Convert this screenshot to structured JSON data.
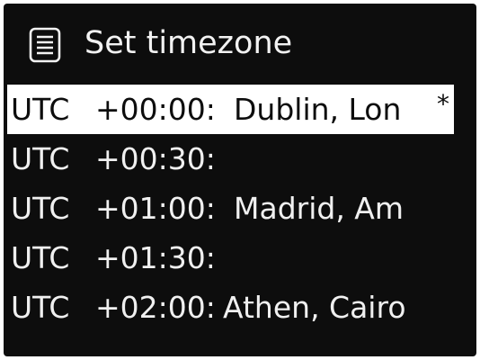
{
  "header": {
    "title": "Set timezone",
    "icon": "menu-list-icon"
  },
  "timezones": [
    {
      "prefix": "UTC",
      "offset": "+00:00:",
      "cities": "Dublin, Lon",
      "marker": "*",
      "selected": true
    },
    {
      "prefix": "UTC",
      "offset": "+00:30:",
      "cities": "",
      "marker": "",
      "selected": false
    },
    {
      "prefix": "UTC",
      "offset": "+01:00:",
      "cities": "Madrid, Am",
      "marker": "",
      "selected": false
    },
    {
      "prefix": "UTC",
      "offset": "+01:30:",
      "cities": "",
      "marker": "",
      "selected": false
    },
    {
      "prefix": "UTC",
      "offset": "+02:00:",
      "cities": "Athen, Cairo",
      "marker": "",
      "selected": false
    }
  ],
  "colors": {
    "background": "#0d0d0d",
    "text": "#f0f0f0",
    "highlight": "#ffffff",
    "highlight_text": "#0d0d0d"
  }
}
